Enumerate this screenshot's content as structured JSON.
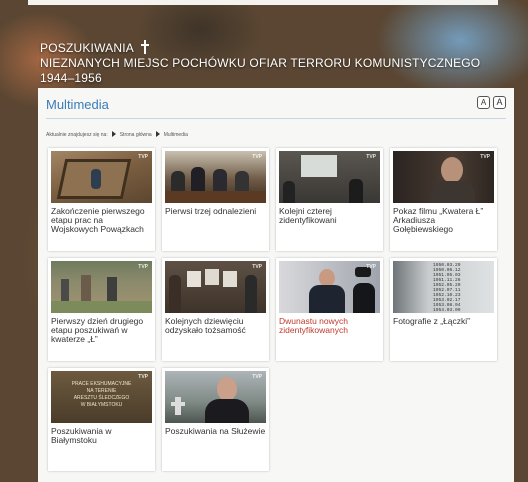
{
  "header": {
    "title_line1": "POSZUKIWANIA",
    "title_line2": "NIEZNANYCH MIEJSC POCHÓWKU OFIAR TERRORU KOMUNISTYCZNEGO 1944–1956"
  },
  "panel": {
    "title": "Multimedia",
    "font_small": "A",
    "font_large": "A"
  },
  "breadcrumb": {
    "prefix": "Aktualnie znajdujesz się na:",
    "home": "Strona główna",
    "current": "Multimedia"
  },
  "items": [
    {
      "label": "Zakończenie pierwszego etapu prac na Wojskowych Powązkach",
      "highlight": false,
      "thumb": "excavation-site"
    },
    {
      "label": "Pierwsi trzej odnalezieni",
      "highlight": false,
      "thumb": "press-conference"
    },
    {
      "label": "Kolejni czterej zidentyfikowani",
      "highlight": false,
      "thumb": "conference-hall"
    },
    {
      "label": "Pokaz filmu „Kwatera Ł” Arkadiusza Gołębiewskiego",
      "highlight": false,
      "thumb": "man-portrait"
    },
    {
      "label": "Pierwszy dzień drugiego etapu poszukiwań w kwaterze „Ł”",
      "highlight": false,
      "thumb": "cemetery-workers"
    },
    {
      "label": "Kolejnych dziewięciu odzyskało tożsamość",
      "highlight": false,
      "thumb": "photo-exhibition"
    },
    {
      "label": "Dwunastu nowych zidentyfikowanych",
      "highlight": true,
      "thumb": "officials-speech"
    },
    {
      "label": "Fotografie z „Łączki”",
      "highlight": false,
      "thumb": "date-list"
    },
    {
      "label": "Poszukiwania w Białymstoku",
      "highlight": false,
      "thumb": "bialystok-title"
    },
    {
      "label": "Poszukiwania na Służewie",
      "highlight": false,
      "thumb": "priest-cemetery"
    }
  ],
  "thumb_texts": {
    "tvp": "TVP",
    "bialystok_lines": [
      "PRACE EKSHUMACYJNE",
      "NA TERENIE",
      "ARESZTU ŚLEDCZEGO",
      "W BIAŁYMSTOKU"
    ],
    "dates": [
      "1950.03.29",
      "1950.06.12",
      "1951.05.03",
      "1951.11.26",
      "1952.05.20",
      "1952.07.11",
      "1952.10.23",
      "1953.02.17",
      "1953.08.04",
      "1954.03.09"
    ]
  },
  "colors": {
    "accent": "#3a7db8",
    "highlight": "#c0392b"
  }
}
